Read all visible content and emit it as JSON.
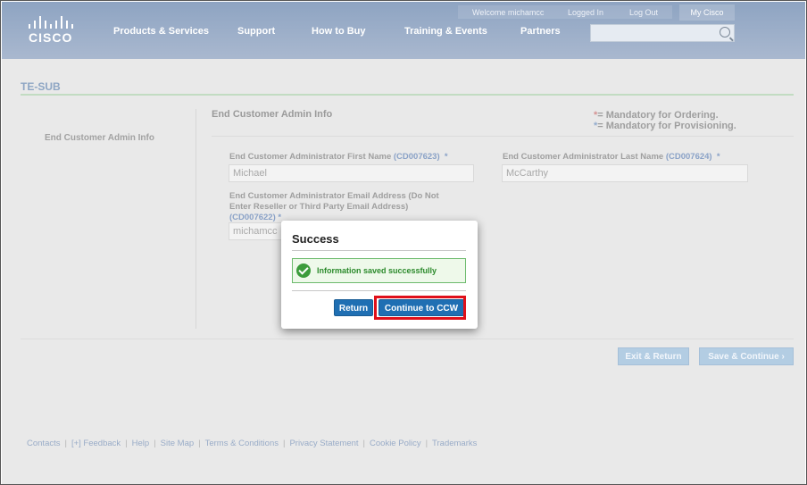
{
  "header": {
    "logo_text": "CISCO",
    "nav": [
      "Products & Services",
      "Support",
      "How to Buy",
      "Training & Events",
      "Partners"
    ],
    "welcome": "Welcome  michamcc",
    "logged_in": "Logged In",
    "logout": "Log Out",
    "my_cisco": "My Cisco",
    "search_placeholder": ""
  },
  "page": {
    "title": "TE-SUB",
    "left_label": "End Customer Admin Info",
    "section_title": "End Customer Admin Info",
    "legend_ordering": "= Mandatory for Ordering.",
    "legend_provisioning": "= Mandatory for Provisioning.",
    "first_name": {
      "label": "End Customer Administrator First Name",
      "code": "(CD007623)",
      "value": "Michael"
    },
    "last_name": {
      "label": "End Customer Administrator Last Name",
      "code": "(CD007624)",
      "value": "McCarthy"
    },
    "email": {
      "label_line1": "End Customer Administrator Email Address (Do Not",
      "label_line2": "Enter Reseller or Third Party Email Address)",
      "code": "(CD007622)",
      "value": "michamcc"
    },
    "exit_button": "Exit & Return",
    "save_button": "Save & Continue"
  },
  "footer": [
    "Contacts",
    "[+] Feedback",
    "Help",
    "Site Map",
    "Terms & Conditions",
    "Privacy Statement",
    "Cookie Policy",
    "Trademarks"
  ],
  "modal": {
    "title": "Success",
    "message": "Information saved successfully",
    "return_button": "Return",
    "continue_button": "Continue to CCW"
  },
  "colors": {
    "header_bg": "#8ea4c2",
    "primary_button": "#1f6fb3",
    "success_green": "#3c9c3c",
    "highlight_red": "#e0101a"
  }
}
